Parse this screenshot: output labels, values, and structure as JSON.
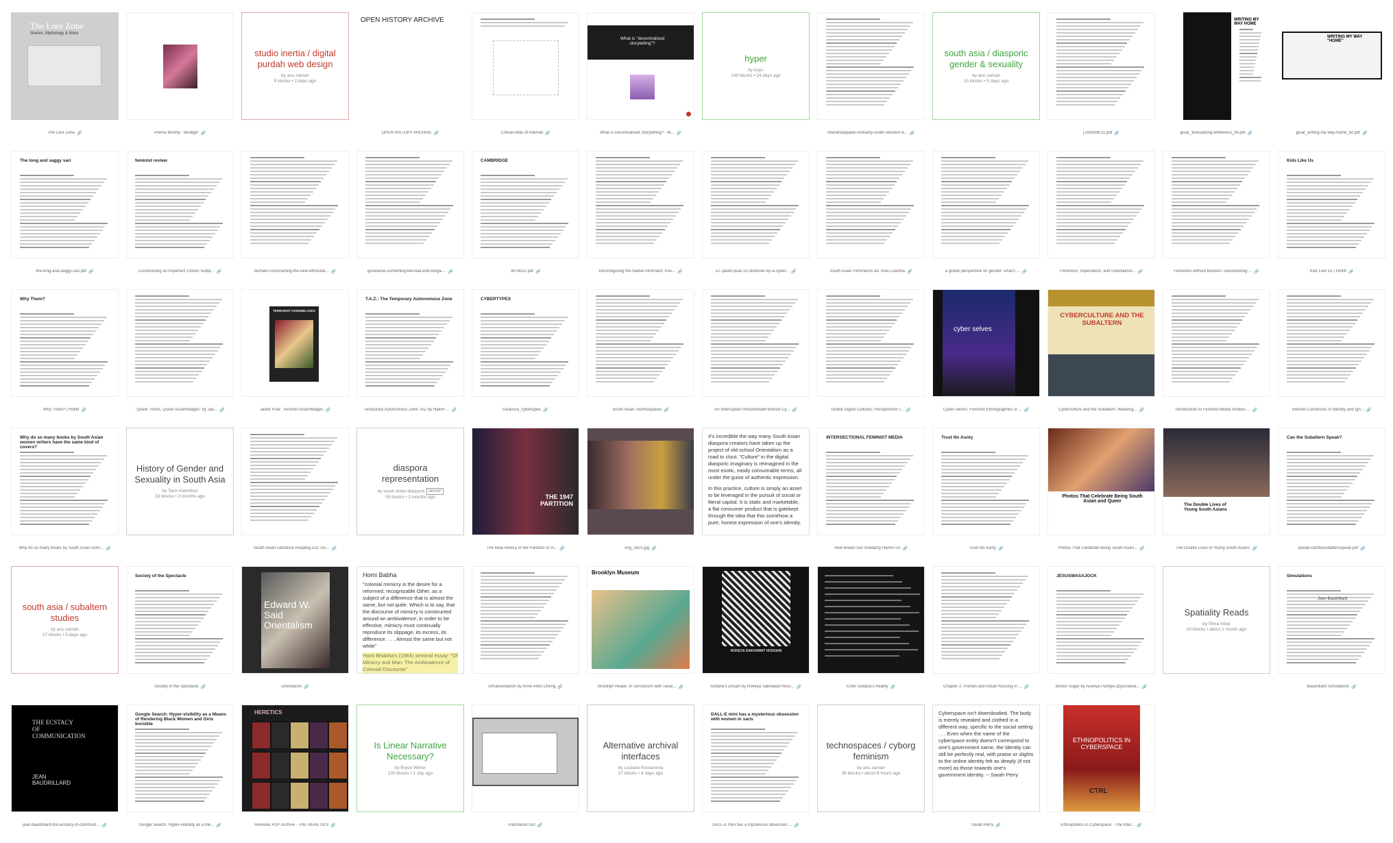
{
  "colors": {
    "channel_red": "#c0392b",
    "channel_green": "#3ba43b",
    "channel_gray": "#444444"
  },
  "row1": [
    {
      "kind": "image",
      "caption": "The Lore Zone",
      "title": "The Lore Zone",
      "subtitle": "Stories, Mythology & More"
    },
    {
      "kind": "image",
      "caption": "Prema Murthy - Bindigirl"
    },
    {
      "kind": "channel",
      "color": "red",
      "title": "studio inertia / digital purdah web design",
      "by": "by anu zaman",
      "stats": "9 blocks • 2 days ago"
    },
    {
      "kind": "image",
      "caption": "OPEN HISTORY ARCHIVE",
      "title": "OPEN HISTORY ARCHIVE"
    },
    {
      "kind": "image",
      "caption": "Critical Atlas of Internet"
    },
    {
      "kind": "image",
      "caption": "What is Decentralised Storytelling? - M...",
      "title": "What is \"decentralized storytelling\"?"
    },
    {
      "kind": "channel",
      "color": "green",
      "title": "hyper",
      "by": "by koyu",
      "stats": "149 blocks • 24 days ago"
    },
    {
      "kind": "doc",
      "caption": "chandrataipade-mohanty-under-western-e..."
    },
    {
      "kind": "channel",
      "color": "green",
      "title": "south asia / diasporic gender & sexuality",
      "by": "by anu zaman",
      "stats": "15 blocks • 5 days ago"
    },
    {
      "kind": "doc",
      "caption": "j.ctvh9r8t.11.pdf"
    },
    {
      "kind": "doc",
      "caption": "jpuar_textualizing-whiteness_txt.pdf",
      "title": "WRITING MY WAY HOME"
    },
    {
      "kind": "doc",
      "caption": "jpuar_writing-my-way-home_txt.pdf",
      "title": "WRITING MY WAY \"HOME\""
    }
  ],
  "row2": [
    {
      "kind": "doc",
      "caption": "the-long-and-saggy-sari.pdf",
      "title": "The long and saggy sari"
    },
    {
      "kind": "doc",
      "caption": "Constructing an Imperfect Citizen Subje...",
      "title": "feminist review"
    },
    {
      "kind": "doc",
      "caption": "durham-constructing-the-new-ethnicitie..."
    },
    {
      "kind": "doc",
      "caption": "gunasena-something-like-ball-and-durga-..."
    },
    {
      "kind": "doc",
      "caption": "3876012.pdf",
      "title": "CAMBRIDGE"
    },
    {
      "kind": "doc",
      "caption": "Reconfiguring the Native Informant: Pos..."
    },
    {
      "kind": "doc",
      "caption": "12.-jasbir-puar-22-stretcher-by-a-cyber..."
    },
    {
      "kind": "doc",
      "caption": "South Asian Feminisms ed. Ania Loomba"
    },
    {
      "kind": "doc",
      "caption": "a global perspective on gender: what's ..."
    },
    {
      "kind": "doc",
      "caption": "Feminism, Imperialism, and Orientalism..."
    },
    {
      "kind": "doc",
      "caption": "Feminism without Borders: Decolonizing ..."
    },
    {
      "kind": "doc",
      "caption": "Kids Like Us | Hotlift",
      "title": "Kids Like Us"
    }
  ],
  "row3": [
    {
      "kind": "doc",
      "caption": "Why Them? | Hotlift",
      "title": "Why Them?"
    },
    {
      "kind": "doc",
      "caption": "\"Queer Times, Queer Assemblages\" by Jas..."
    },
    {
      "kind": "image",
      "caption": "Jasbir Puar: Terrorist Assemblages",
      "title": "TERRORIST ASSEMBLAGES"
    },
    {
      "kind": "doc",
      "caption": "Temporary Autonomous Zone TAZ by Hakim ...",
      "title": "T.A.Z.: The Temporary Autonomous Zone"
    },
    {
      "kind": "doc",
      "caption": "rukanura_cybertypes",
      "title": "CYBERTYPES"
    },
    {
      "kind": "doc",
      "caption": "South Asian Technospaces"
    },
    {
      "kind": "doc",
      "caption": "An Interrupted Postcolonial/Feminist Cy..."
    },
    {
      "kind": "doc",
      "caption": "Global Digital Cultures: Perspectives f..."
    },
    {
      "kind": "image",
      "caption": "Cyber-selves: Feminist Ethnographies of ...",
      "title": "cyber selves"
    },
    {
      "kind": "image",
      "caption": "Cyberculture and the Subaltern: Weaving...",
      "title": "CYBERCULTURE AND THE SUBALTERN"
    },
    {
      "kind": "doc",
      "caption": "Introduction to Feminist Media Studies ..."
    },
    {
      "kind": "doc",
      "caption": "Internet Constructs of Identity and Ign..."
    }
  ],
  "row4": [
    {
      "kind": "doc",
      "caption": "Why do so many books by South Asian wom...",
      "title": "Why do so many books by South Asian women writers have the same kind of covers?"
    },
    {
      "kind": "channel",
      "color": "gray",
      "title": "History of Gender and Sexuality in South Asia",
      "by": "by Tarin Karimbux",
      "stats": "33 blocks • 2 months ago"
    },
    {
      "kind": "doc",
      "caption": "South Asian Literature Reading List: Go..."
    },
    {
      "kind": "channel",
      "color": "private",
      "title": "diaspora representation",
      "by": "by south asian diaspora",
      "badge": "GROUP",
      "stats": "55 blocks • 2 months ago"
    },
    {
      "kind": "image",
      "caption": "The Real History of the Partition of In...",
      "title": "THE 1947 PARTITION"
    },
    {
      "kind": "image",
      "caption": "img_3623.jpg"
    },
    {
      "kind": "text",
      "paras": [
        "It's incredible the way many South Asian diaspora creators have taken up the project of old-school Orientalism as a road to clout. \"Culture\" in the digital diasporic imaginary is reimagined in the most exotic, easily consumable terms, all under the guise of authentic expression.",
        "In this practice, culture is simply an asset to be leveraged in the pursuit of social or literal capital. It is static and marketable, a flat consumer product that is gatekept through the idea that this somehow a pure, honest expression of one's identity."
      ]
    },
    {
      "kind": "doc",
      "caption": "How Brown Girl Solidarity Harms Us",
      "title": "INTERSECTIONAL FEMINIST MEDIA"
    },
    {
      "kind": "doc",
      "caption": "Trust No Aunty",
      "title": "Trust No Aunty"
    },
    {
      "kind": "image",
      "caption": "Photos That Celebrate Being South Asian...",
      "title": "Photos That Celebrate Being South Asian and Queer"
    },
    {
      "kind": "image",
      "caption": "The Double Lives of Young South Asians",
      "title": "The Double Lives of Young South Asians"
    },
    {
      "kind": "doc",
      "caption": "spivak-canthesubalternspeak.pdf",
      "title": "Can the Subaltern Speak?"
    }
  ],
  "row5": [
    {
      "kind": "channel",
      "color": "red",
      "title": "south asia / subaltern studies",
      "by": "by anu zaman",
      "stats": "27 blocks • 5 days ago"
    },
    {
      "kind": "doc",
      "caption": "Society of the Spectacle",
      "title": "Society of the Spectacle"
    },
    {
      "kind": "image",
      "caption": "Orientalism",
      "title": "Edward W. Said Orientalism"
    },
    {
      "kind": "quote",
      "head": "Homi Babha",
      "body": "\"colonial mimicry is the desire for a reformed, recognizable Other, as a subject of a difference that is almost the same, but not quite. Which is to say, that the discourse of mimicry is constructed around an ambivalence; in order to be effective, mimicry must continually reproduce its slippage, its excess, its difference. . . . Almost the same but not white\"",
      "hl": "Homi Bhabha's (1984) seminal essay: \"Of Mimicry and Man: The Ambivalence of Colonial Discourse\""
    },
    {
      "kind": "doc",
      "caption": "Ornamentalism by Anne Anlin Cheng"
    },
    {
      "kind": "image",
      "caption": "Brooklyn Reads: In Sensorium with Tanaï...",
      "title": "Brooklyn Museum"
    },
    {
      "kind": "image",
      "caption": "Sultana's Dream by Rokeya Sakhawat Hoss...",
      "title": "ROKEYA SAKHAWAT HOSSAIN"
    },
    {
      "kind": "image",
      "caption": "Enter Sultana's Reality"
    },
    {
      "kind": "doc",
      "caption": "Chapter 2: Purdah and Ritual Housing in ..."
    },
    {
      "kind": "doc",
      "caption": "Brown Sugar by Ananya Pandya @jezsweat...",
      "title": "JESUSWASAJOCK"
    },
    {
      "kind": "channel",
      "color": "gray",
      "title": "Spatiality Reads",
      "by": "by Shira Inbar",
      "stats": "33 blocks • about 1 month ago"
    },
    {
      "kind": "doc",
      "caption": "Baudrillard Simulations",
      "title": "Simulations",
      "sub": "Jean Baudrillard"
    }
  ],
  "row6": [
    {
      "kind": "image",
      "caption": "jean-baudrillard-the-ecstacy-of-communi...",
      "title": "THE ECSTACY OF COMMUNICATION",
      "sub": "JEAN BAUDRILLARD"
    },
    {
      "kind": "doc",
      "caption": "Google Search: Hyper-visibility as a Me...",
      "title": "Google Search: Hyper-visibility as a Means of Rendering Black Women and Girls Invisible"
    },
    {
      "kind": "image",
      "caption": "Heresies PDF Archive - THE HERETICS",
      "title": "HERETICS"
    },
    {
      "kind": "channel",
      "color": "green",
      "title": "Is Linear Narrative Necessary?",
      "by": "by Bryce Wilner",
      "stats": "130 blocks • 1 day ago"
    },
    {
      "kind": "image",
      "caption": "Patchwork Girl"
    },
    {
      "kind": "channel",
      "color": "gray",
      "title": "Alternative archival interfaces",
      "by": "by Luciana Rossenova",
      "stats": "57 blocks • 4 days ago"
    },
    {
      "kind": "doc",
      "caption": "DALL-E mini has a mysterious obsession ...",
      "title": "DALL-E mini has a mysterious obsession with women in saris"
    },
    {
      "kind": "channel",
      "color": "gray",
      "title": "technospaces / cyborg feminism",
      "by": "by anu zaman",
      "stats": "36 blocks • about 6 hours ago"
    },
    {
      "kind": "text",
      "caption": "Sarah Perry",
      "paras": [
        "Cyberspace isn't disembodied. The body is merely revealed and clothed in a different way, specific to the social setting . . . Even when the name of the cyberspace entity doesn't correspond to one's government name, the identity can still be perfectly real, with praise or slights to the online identity felt as deeply (if not more) as those towards one's government identity. -- Sarah Perry"
      ]
    },
    {
      "kind": "image",
      "caption": "Ethnopolitics in Cyberspace - The Inter...",
      "title": "ETHNOPOLITICS IN CYBERSPACE",
      "sub": "CTRL"
    }
  ]
}
